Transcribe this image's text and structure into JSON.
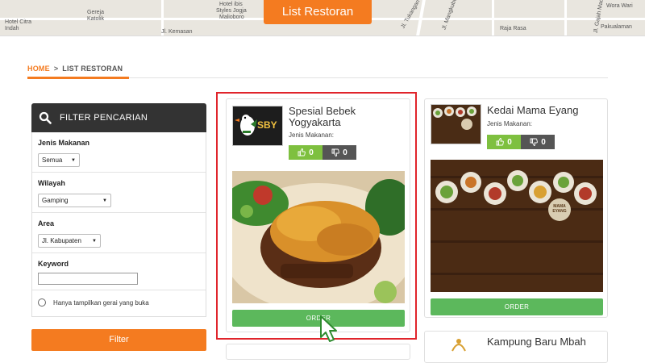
{
  "map": {
    "title": "List Restoran",
    "labels": [
      "Hotel Citra",
      "Indah",
      "Gereja",
      "Katolik",
      "Hotel ibis",
      "Styles Jogja",
      "Malioboro",
      "Raja Rasa",
      "Jl. Kemasan",
      "Jl. Tukangan",
      "Jl. Mangkubumi",
      "Jl. Gajah Mada",
      "Pakualaman",
      "Wora Wari"
    ]
  },
  "breadcrumb": {
    "home": "HOME",
    "separator": ">",
    "current": "LIST RESTORAN"
  },
  "filter": {
    "title": "FILTER PENCARIAN",
    "jenis_label": "Jenis Makanan",
    "jenis_value": "Semua",
    "wilayah_label": "Wilayah",
    "wilayah_value": "Gamping",
    "area_label": "Area",
    "area_value": "Jl. Kabupaten",
    "keyword_label": "Keyword",
    "keyword_value": "",
    "open_only_label": "Hanya tampilkan gerai yang buka",
    "button": "Filter"
  },
  "restaurants": [
    {
      "name": "Spesial Bebek Yogyakarta",
      "type_label": "Jenis Makanan:",
      "likes": "0",
      "dislikes": "0",
      "order": "ORDER",
      "logo_text": "SBY"
    },
    {
      "name": "Kedai Mama Eyang",
      "type_label": "Jenis Makanan:",
      "likes": "0",
      "dislikes": "0",
      "order": "ORDER",
      "logo_text": "MAMA EYANG"
    },
    {
      "name": "Kampung Baru Mbah"
    }
  ],
  "colors": {
    "accent": "#f47b20",
    "green": "#5cb85c",
    "like": "#7ec03f",
    "dark": "#333333",
    "highlight": "#e0242b"
  }
}
